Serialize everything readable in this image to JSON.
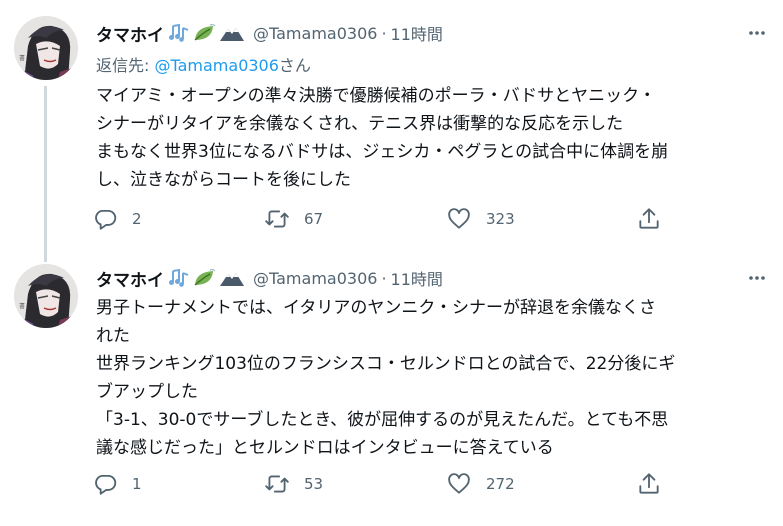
{
  "tweets": [
    {
      "name": "タマホイ",
      "handle": "@Tamama0306",
      "time": "11時間",
      "reply_prefix": "返信先: ",
      "reply_to": "@Tamama0306",
      "reply_suffix": "さん",
      "lines": [
        "マイアミ・オープンの準々決勝で優勝候補のポーラ・バドサとヤニック・",
        "シナーがリタイアを余儀なくされ、テニス界は衝撃的な反応を示した",
        "まもなく世界3位になるバドサは、ジェシカ・ペグラとの試合中に体調を崩",
        "し、泣きながらコートを後にした"
      ],
      "replies": "2",
      "retweets": "67",
      "likes": "323"
    },
    {
      "name": "タマホイ",
      "handle": "@Tamama0306",
      "time": "11時間",
      "lines": [
        "男子トーナメントでは、イタリアのヤンニク・シナーが辞退を余儀なくさ",
        "れた",
        "世界ランキング103位のフランシスコ・セルンドロとの試合で、22分後にギ",
        "ブアップした",
        "「3-1、30-0でサーブしたとき、彼が屈伸するのが見えたんだ。とても不思",
        "議な感じだった」とセルンドロはインタビューに答えている"
      ],
      "replies": "1",
      "retweets": "53",
      "likes": "272"
    }
  ],
  "colors": {
    "text": "#0f1419",
    "muted": "#536471",
    "link": "#1d9bf0",
    "thread_line": "#cfd9de"
  },
  "icons": [
    "music-notes-icon",
    "leaf-icon",
    "mountain-icon",
    "more-icon",
    "reply-icon",
    "retweet-icon",
    "like-icon",
    "share-icon"
  ]
}
